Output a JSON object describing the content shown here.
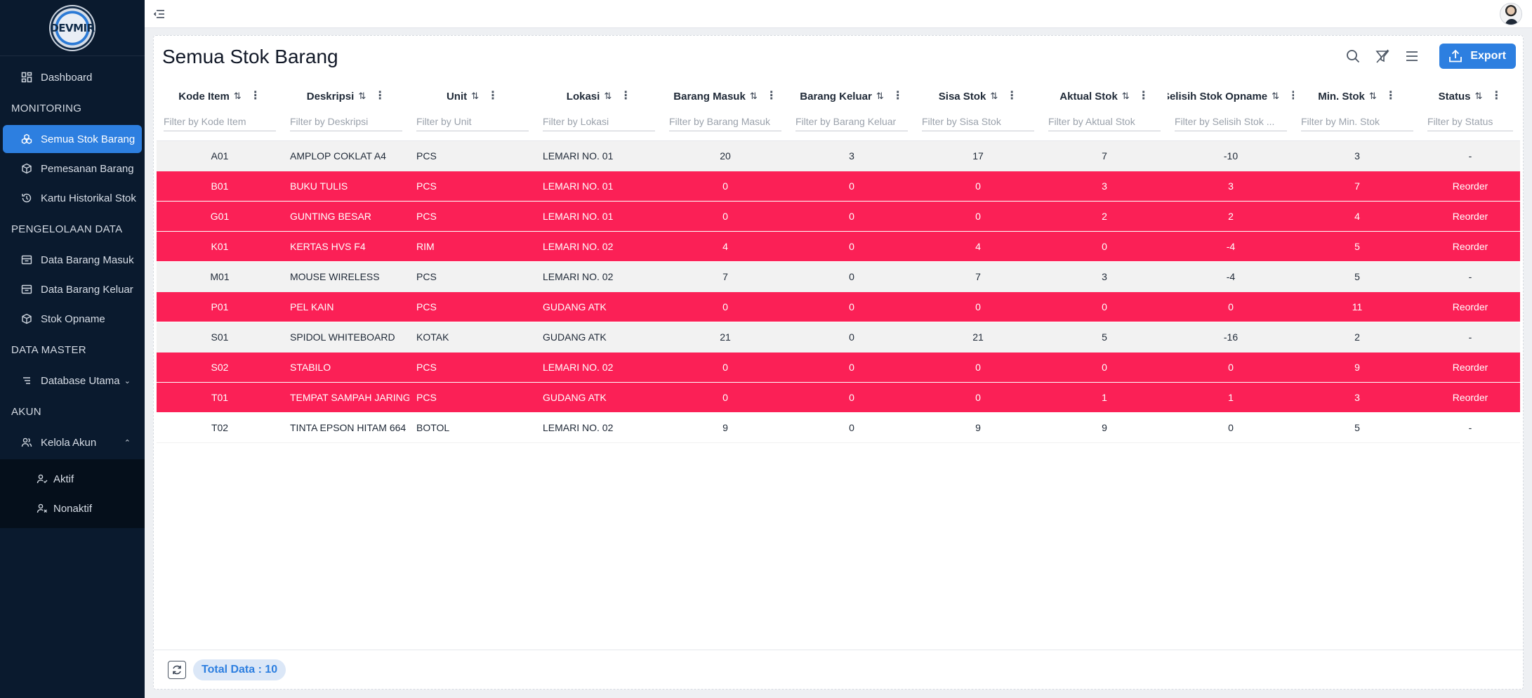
{
  "app": {
    "logo_text": "DEVMIR"
  },
  "sidebar": {
    "sections": [
      {
        "title": "MONITORING"
      },
      {
        "title": "PENGELOLAAN DATA"
      },
      {
        "title": "DATA MASTER"
      },
      {
        "title": "AKUN"
      }
    ],
    "dashboard": {
      "label": "Dashboard",
      "icon": "dashboard-icon"
    },
    "monitoring_items": [
      {
        "label": "Semua Stok Barang",
        "icon": "boxes-icon",
        "active": true
      },
      {
        "label": "Pemesanan Barang",
        "icon": "package-icon"
      },
      {
        "label": "Kartu Historikal Stok",
        "icon": "history-icon"
      }
    ],
    "pengelolaan_items": [
      {
        "label": "Data Barang Masuk",
        "icon": "inbox-icon"
      },
      {
        "label": "Data Barang Keluar",
        "icon": "outbox-icon"
      },
      {
        "label": "Stok Opname",
        "icon": "package-icon"
      }
    ],
    "master_items": [
      {
        "label": "Database Utama",
        "icon": "list-icon",
        "chevron": "chevron-down-icon"
      }
    ],
    "akun_items": [
      {
        "label": "Kelola Akun",
        "icon": "users-icon",
        "chevron": "chevron-up-icon"
      }
    ],
    "akun_sub_items": [
      {
        "label": "Aktif",
        "icon": "user-check-icon"
      },
      {
        "label": "Nonaktif",
        "icon": "user-x-icon"
      }
    ]
  },
  "main": {
    "title": "Semua Stok Barang",
    "toolbar": {
      "export_label": "Export"
    },
    "columns": [
      {
        "label": "Kode Item",
        "placeholder": "Filter by Kode Item"
      },
      {
        "label": "Deskripsi",
        "placeholder": "Filter by Deskripsi"
      },
      {
        "label": "Unit",
        "placeholder": "Filter by Unit"
      },
      {
        "label": "Lokasi",
        "placeholder": "Filter by Lokasi"
      },
      {
        "label": "Barang Masuk",
        "placeholder": "Filter by Barang Masuk"
      },
      {
        "label": "Barang Keluar",
        "placeholder": "Filter by Barang Keluar"
      },
      {
        "label": "Sisa Stok",
        "placeholder": "Filter by Sisa Stok"
      },
      {
        "label": "Aktual Stok",
        "placeholder": "Filter by Aktual Stok"
      },
      {
        "label": "Selisih Stok Opname",
        "placeholder": "Filter by Selisih Stok ..."
      },
      {
        "label": "Min. Stok",
        "placeholder": "Filter by Min. Stok"
      },
      {
        "label": "Status",
        "placeholder": "Filter by Status"
      }
    ],
    "rows": [
      {
        "kode": "A01",
        "deskripsi": "AMPLOP COKLAT A4",
        "unit": "PCS",
        "lokasi": "LEMARI NO. 01",
        "masuk": "20",
        "keluar": "3",
        "sisa": "17",
        "aktual": "7",
        "selisih": "-10",
        "min": "3",
        "status": "-"
      },
      {
        "kode": "B01",
        "deskripsi": "BUKU TULIS",
        "unit": "PCS",
        "lokasi": "LEMARI NO. 01",
        "masuk": "0",
        "keluar": "0",
        "sisa": "0",
        "aktual": "3",
        "selisih": "3",
        "min": "7",
        "status": "Reorder"
      },
      {
        "kode": "G01",
        "deskripsi": "GUNTING BESAR",
        "unit": "PCS",
        "lokasi": "LEMARI NO. 01",
        "masuk": "0",
        "keluar": "0",
        "sisa": "0",
        "aktual": "2",
        "selisih": "2",
        "min": "4",
        "status": "Reorder"
      },
      {
        "kode": "K01",
        "deskripsi": "KERTAS HVS F4",
        "unit": "RIM",
        "lokasi": "LEMARI NO. 02",
        "masuk": "4",
        "keluar": "0",
        "sisa": "4",
        "aktual": "0",
        "selisih": "-4",
        "min": "5",
        "status": "Reorder"
      },
      {
        "kode": "M01",
        "deskripsi": "MOUSE WIRELESS",
        "unit": "PCS",
        "lokasi": "LEMARI NO. 02",
        "masuk": "7",
        "keluar": "0",
        "sisa": "7",
        "aktual": "3",
        "selisih": "-4",
        "min": "5",
        "status": "-"
      },
      {
        "kode": "P01",
        "deskripsi": "PEL KAIN",
        "unit": "PCS",
        "lokasi": "GUDANG ATK",
        "masuk": "0",
        "keluar": "0",
        "sisa": "0",
        "aktual": "0",
        "selisih": "0",
        "min": "11",
        "status": "Reorder"
      },
      {
        "kode": "S01",
        "deskripsi": "SPIDOL WHITEBOARD",
        "unit": "KOTAK",
        "lokasi": "GUDANG ATK",
        "masuk": "21",
        "keluar": "0",
        "sisa": "21",
        "aktual": "5",
        "selisih": "-16",
        "min": "2",
        "status": "-"
      },
      {
        "kode": "S02",
        "deskripsi": "STABILO",
        "unit": "PCS",
        "lokasi": "LEMARI NO. 02",
        "masuk": "0",
        "keluar": "0",
        "sisa": "0",
        "aktual": "0",
        "selisih": "0",
        "min": "9",
        "status": "Reorder"
      },
      {
        "kode": "T01",
        "deskripsi": "TEMPAT SAMPAH JARING",
        "unit": "PCS",
        "lokasi": "GUDANG ATK",
        "masuk": "0",
        "keluar": "0",
        "sisa": "0",
        "aktual": "1",
        "selisih": "1",
        "min": "3",
        "status": "Reorder"
      },
      {
        "kode": "T02",
        "deskripsi": "TINTA EPSON HITAM 664",
        "unit": "BOTOL",
        "lokasi": "LEMARI NO. 02",
        "masuk": "9",
        "keluar": "0",
        "sisa": "9",
        "aktual": "9",
        "selisih": "0",
        "min": "5",
        "status": "-"
      }
    ],
    "footer": {
      "total_label": "Total Data : 10"
    }
  },
  "colors": {
    "accent": "#2d7fe0",
    "sidebar_bg": "#0a1a2e",
    "reorder_row": "#fb2056"
  }
}
